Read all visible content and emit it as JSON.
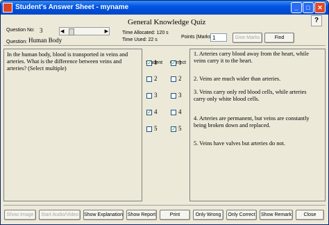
{
  "window": {
    "title": "Student's Answer Sheet - myname"
  },
  "header": {
    "quiz_title": "General Knowledge Quiz",
    "question_no_label": "Question No:",
    "question_no": "3",
    "question_label": "Question:",
    "question_topic": "Human Body",
    "time_allocated": "Time Allocated: 120 s",
    "time_used": "Time Used: 22 s",
    "points_label": "Points (Marks):",
    "points_value": "1",
    "give_marks_label": "Give Marks",
    "find_label": "Find",
    "help_icon_glyph": "?"
  },
  "question_text": "In the human body, blood is transported in veins and arteries. What is the difference between veins and arteries? (Select multiple)",
  "columns": {
    "student": "Student",
    "correct": "Correct"
  },
  "options": [
    {
      "num": "1",
      "student_checked": true,
      "correct_checked": true,
      "text": "1.  Arteries carry blood away from the heart, while veins carry it to the heart."
    },
    {
      "num": "2",
      "student_checked": false,
      "correct_checked": false,
      "text": "2.  Veins are much wider than arteries."
    },
    {
      "num": "3",
      "student_checked": false,
      "correct_checked": false,
      "text": "3.  Veins carry only red blood cells, while arteries carry only white blood cells."
    },
    {
      "num": "4",
      "student_checked": true,
      "correct_checked": false,
      "text": "4.  Arteries are permanent, but veins are constantly being broken down and replaced."
    },
    {
      "num": "5",
      "student_checked": false,
      "correct_checked": true,
      "text": "5.  Veins have valves but arteries do not."
    }
  ],
  "footer_buttons": {
    "show_image": "Show Image",
    "start_audio_video": "Start Audio/Video",
    "show_explanation": "Show Explanation",
    "show_report": "Show Report",
    "print": "Print",
    "only_wrong": "Only Wrong",
    "only_correct": "Only Correct",
    "show_remark": "Show Remark",
    "close": "Close"
  },
  "icons": [
    "minimize-icon",
    "maximize-icon",
    "close-icon",
    "help-icon",
    "scroll-left-icon",
    "scroll-right-icon",
    "app-icon"
  ]
}
